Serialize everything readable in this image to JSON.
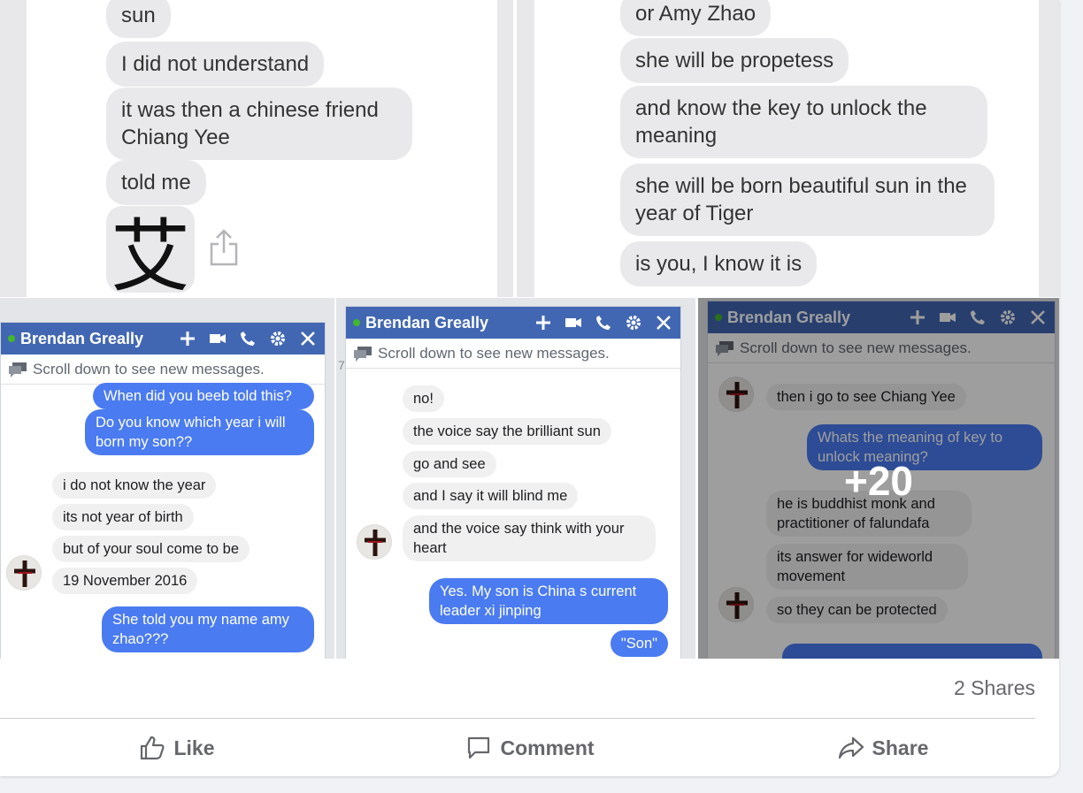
{
  "post": {
    "shares": "2 Shares",
    "actions": {
      "like": "Like",
      "comment": "Comment",
      "share": "Share"
    }
  },
  "top_left": {
    "bubbles": [
      "sun",
      "I did not understand",
      "it was then a chinese friend Chiang Yee",
      "told me"
    ],
    "character": "艾"
  },
  "top_right": {
    "bubbles": [
      "or Amy Zhao",
      "she will be propetess",
      "and know the key to unlock the meaning",
      "she will be born beautiful sun in the year of Tiger",
      "is you, I know it is"
    ]
  },
  "chat_common": {
    "name": "Brendan Greally",
    "scroll_note": "Scroll down to see new messages."
  },
  "chat1": {
    "out1": "When did you beeb told this?",
    "out2": "Do you know which year i will born my son??",
    "in1": "i do not know the year",
    "in2": "its not year of birth",
    "in3": "but of your soul come to be",
    "in4": "19 November 2016",
    "out3": "She told you my name amy zhao???"
  },
  "chat2": {
    "in1": "no!",
    "in2": "the voice say the brilliant sun",
    "in3": "go and see",
    "in4": "and I say it will blind me",
    "in5": "and the voice say think with your heart",
    "out1": "Yes. My son is China s current leader xi jinping",
    "out2": "\"Son\""
  },
  "chat3": {
    "in1": "then i go to see Chiang Yee",
    "out1": "Whats the meaning of key to unlock meaning?",
    "in2": "he is buddhist monk and practitioner of falundafa",
    "in3": "its answer for wideworld movement",
    "in4": "so they can be protected",
    "more": "+20"
  },
  "colors": {
    "messenger_blue": "#4a7bf0",
    "facebook_header": "#4267b2",
    "imessage_gray": "#e9e9eb"
  }
}
